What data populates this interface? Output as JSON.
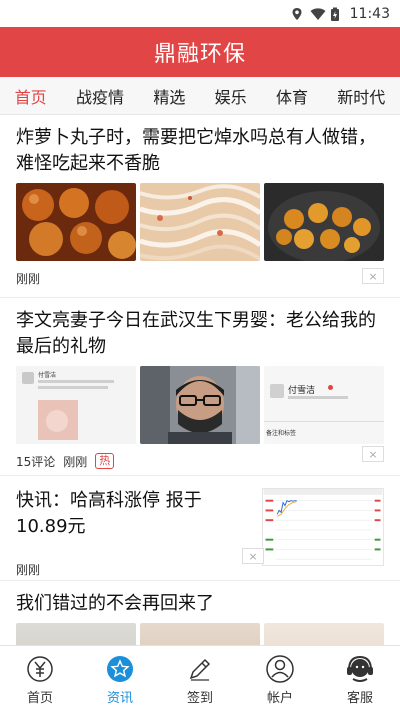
{
  "status_bar": {
    "time": "11:43"
  },
  "app": {
    "title": "鼎融环保"
  },
  "tabs": [
    {
      "label": "首页",
      "active": true
    },
    {
      "label": "战疫情",
      "active": false
    },
    {
      "label": "精选",
      "active": false
    },
    {
      "label": "娱乐",
      "active": false
    },
    {
      "label": "体育",
      "active": false
    },
    {
      "label": "新时代",
      "active": false
    }
  ],
  "feed": [
    {
      "title": "炸萝卜丸子时，需要把它焯水吗总有人做错，难怪吃起来不香脆",
      "meta": "刚刚"
    },
    {
      "title": "李文亮妻子今日在武汉生下男婴：老公给我的最后的礼物",
      "comments": "15评论",
      "time": "刚刚",
      "badge": "热",
      "thumb_text": {
        "name_left": "付雪洁",
        "name_right": "付雪洁",
        "caption": "备注和标签"
      }
    },
    {
      "title": "快讯：哈高科涨停 报于10.89元",
      "meta": "刚刚"
    },
    {
      "title": "我们错过的不会再回来了"
    }
  ],
  "close_glyph": "×",
  "bottom_nav": [
    {
      "label": "首页",
      "icon": "yen-icon",
      "active": false
    },
    {
      "label": "资讯",
      "icon": "star-icon",
      "active": true
    },
    {
      "label": "签到",
      "icon": "pencil-icon",
      "active": false
    },
    {
      "label": "帐户",
      "icon": "user-icon",
      "active": false
    },
    {
      "label": "客服",
      "icon": "headset-icon",
      "active": false
    }
  ],
  "colors": {
    "brand_red": "#e24545",
    "active_blue": "#1b8fd9"
  }
}
